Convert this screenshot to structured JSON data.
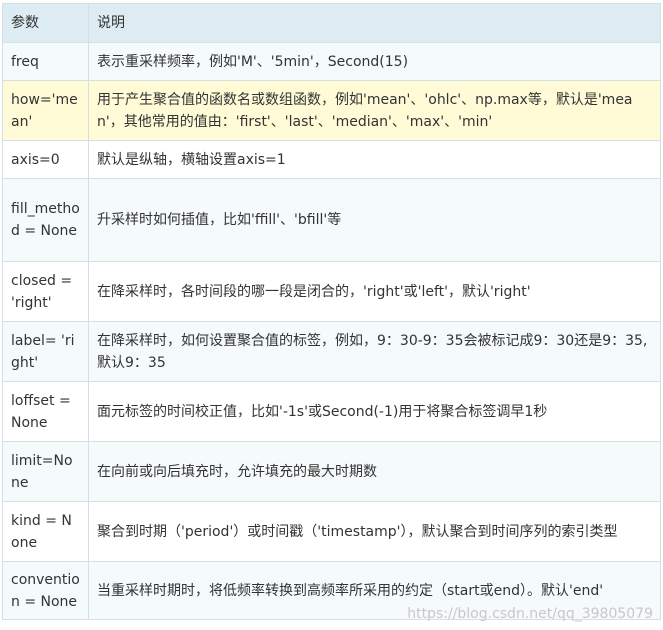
{
  "headers": {
    "param": "参数",
    "desc": "说明"
  },
  "rows": [
    {
      "param": "freq",
      "desc": "表示重采样频率，例如'M'、'5min'，Second(15)",
      "style": "odd"
    },
    {
      "param": "how='mean'",
      "desc": "用于产生聚合值的函数名或数组函数，例如'mean'、'ohlc'、np.max等，默认是'mean'，其他常用的值由：'first'、'last'、'median'、'max'、'min'",
      "style": "hl"
    },
    {
      "param": "axis=0",
      "desc": "默认是纵轴，横轴设置axis=1",
      "style": "even"
    },
    {
      "param": "fill_method = None",
      "desc": "升采样时如何插值，比如'ffill'、'bfill'等",
      "style": "odd"
    },
    {
      "param": "closed = 'right'",
      "desc": "在降采样时，各时间段的哪一段是闭合的，'right'或'left'，默认'right'",
      "style": "even"
    },
    {
      "param": "label= 'right'",
      "desc": "在降采样时，如何设置聚合值的标签，例如，9：30-9：35会被标记成9：30还是9：35,默认9：35",
      "style": "odd"
    },
    {
      "param": "loffset = None",
      "desc": "面元标签的时间校正值，比如'-1s'或Second(-1)用于将聚合标签调早1秒",
      "style": "even"
    },
    {
      "param": "limit=None",
      "desc": "在向前或向后填充时，允许填充的最大时期数",
      "style": "odd"
    },
    {
      "param": "kind = None",
      "desc": "聚合到时期（'period'）或时间戳（'timestamp'），默认聚合到时间序列的索引类型",
      "style": "even"
    },
    {
      "param": "convention = None",
      "desc": "当重采样时期时，将低频率转换到高频率所采用的约定（start或end）。默认'end'",
      "style": "odd"
    }
  ],
  "watermark": "https://blog.csdn.net/qq_39805079"
}
